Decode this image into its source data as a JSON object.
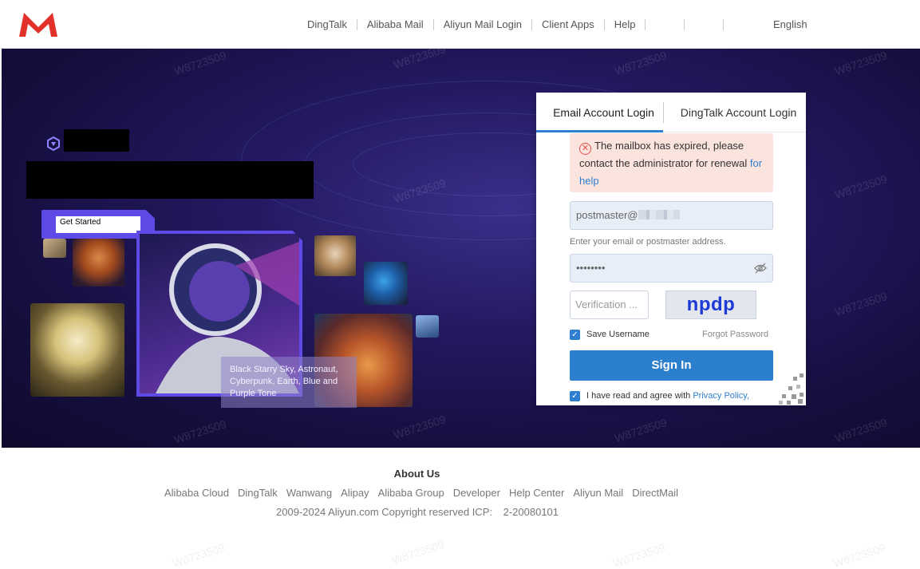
{
  "header": {
    "nav": [
      "DingTalk",
      "Alibaba Mail",
      "Aliyun Mail Login",
      "Client Apps",
      "Help"
    ],
    "language": "English"
  },
  "hero": {
    "watermark": "W8723509",
    "get_started_label": "Get Started",
    "image_caption": "Black Starry Sky, Astronaut, Cyberpunk, Earth, Blue and Purple Tone"
  },
  "login": {
    "tabs": [
      "Email Account Login",
      "DingTalk Account Login"
    ],
    "alert_text": "The mailbox has expired, please contact the administrator for renewal",
    "alert_link": "for help",
    "email_value": "postmaster@",
    "email_hint": "Enter your email or postmaster address.",
    "password_value": "••••••••",
    "verification_placeholder": "Verification ...",
    "captcha_text": "npdp",
    "save_username_label": "Save Username",
    "forgot_password_label": "Forgot Password",
    "sign_in_label": "Sign In",
    "agree_text": "I have read and agree with",
    "privacy_policy_label": "Privacy Policy,"
  },
  "footer": {
    "title": "About Us",
    "links": [
      "Alibaba Cloud",
      "DingTalk",
      "Wanwang",
      "Alipay",
      "Alibaba Group",
      "Developer",
      "Help Center",
      "Aliyun Mail",
      "DirectMail"
    ],
    "copyright": "2009-2024 Aliyun.com Copyright reserved ICP:",
    "icp": "2-20080101"
  },
  "colors": {
    "accent": "#2b7fcc",
    "brand_red": "#e2322b",
    "hero_purple": "#5e4ae6"
  }
}
